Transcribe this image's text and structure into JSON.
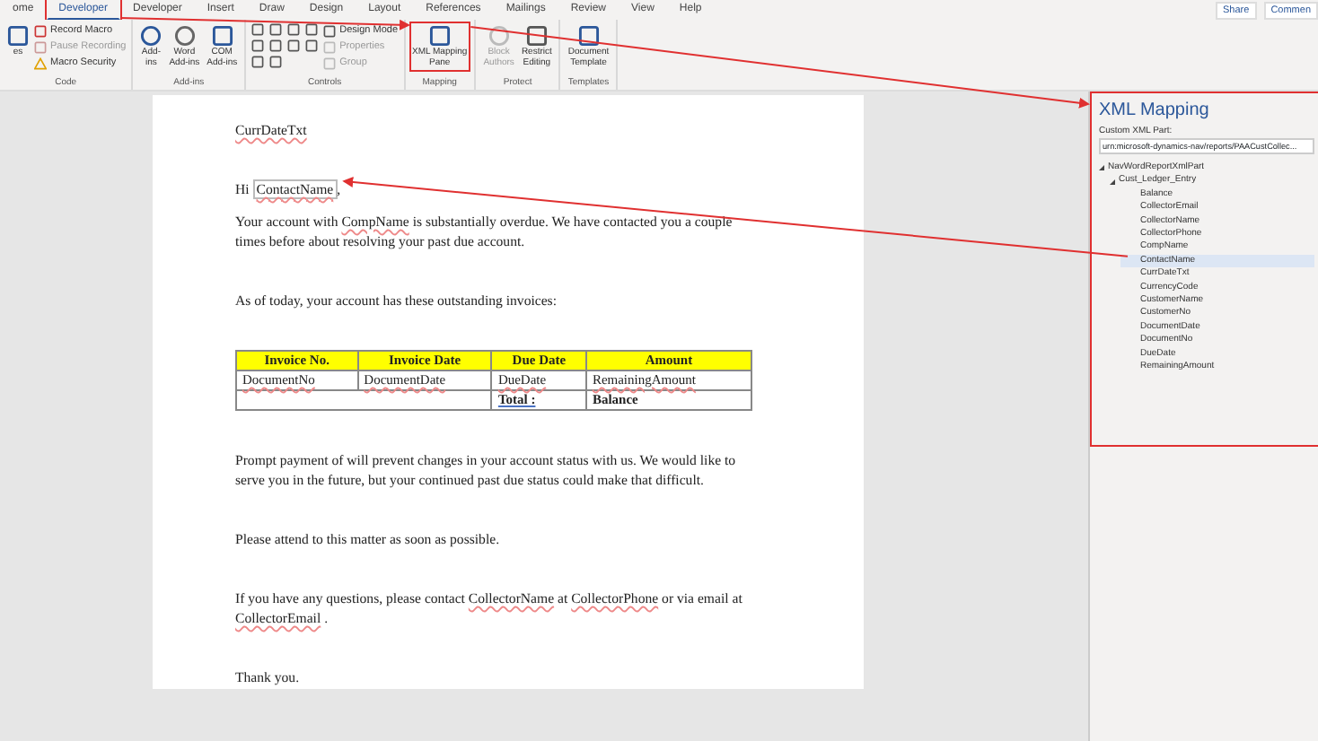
{
  "ribbon_tabs": [
    {
      "label": "ome",
      "selected": false,
      "highlighted": false
    },
    {
      "label": "Developer",
      "selected": true,
      "highlighted": true
    },
    {
      "label": "Developer",
      "selected": false,
      "highlighted": false
    },
    {
      "label": "Insert",
      "selected": false,
      "highlighted": false
    },
    {
      "label": "Draw",
      "selected": false,
      "highlighted": false
    },
    {
      "label": "Design",
      "selected": false,
      "highlighted": false
    },
    {
      "label": "Layout",
      "selected": false,
      "highlighted": false
    },
    {
      "label": "References",
      "selected": false,
      "highlighted": false
    },
    {
      "label": "Mailings",
      "selected": false,
      "highlighted": false
    },
    {
      "label": "Review",
      "selected": false,
      "highlighted": false
    },
    {
      "label": "View",
      "selected": false,
      "highlighted": false
    },
    {
      "label": "Help",
      "selected": false,
      "highlighted": false
    }
  ],
  "share_buttons": [
    "Share",
    "Commen"
  ],
  "ribbon_groups": [
    {
      "name": "Code",
      "buttons": [
        {
          "kind": "large",
          "label": "es",
          "disabled": false,
          "highlighted": false
        },
        {
          "kind": "stack",
          "items": [
            {
              "label": "Record Macro",
              "disabled": false
            },
            {
              "label": "Pause Recording",
              "disabled": true
            },
            {
              "label": "Macro Security",
              "disabled": false
            }
          ]
        }
      ]
    },
    {
      "name": "Add-ins",
      "buttons": [
        {
          "kind": "large",
          "label": "Add-\nins",
          "disabled": false,
          "highlighted": false
        },
        {
          "kind": "large",
          "label": "Word\nAdd-ins",
          "disabled": false,
          "highlighted": false
        },
        {
          "kind": "large",
          "label": "COM\nAdd-ins",
          "disabled": false,
          "highlighted": false
        }
      ]
    },
    {
      "name": "Controls",
      "buttons": [
        {
          "kind": "controls"
        },
        {
          "kind": "stack",
          "items": [
            {
              "label": "Design Mode",
              "disabled": false
            },
            {
              "label": "Properties",
              "disabled": true
            },
            {
              "label": "Group",
              "disabled": true
            }
          ]
        }
      ]
    },
    {
      "name": "Mapping",
      "buttons": [
        {
          "kind": "large",
          "label": "XML Mapping\nPane",
          "disabled": false,
          "highlighted": true
        }
      ]
    },
    {
      "name": "Protect",
      "buttons": [
        {
          "kind": "large",
          "label": "Block\nAuthors",
          "disabled": true,
          "highlighted": false
        },
        {
          "kind": "large",
          "label": "Restrict\nEditing",
          "disabled": false,
          "highlighted": false
        }
      ]
    },
    {
      "name": "Templates",
      "buttons": [
        {
          "kind": "large",
          "label": "Document\nTemplate",
          "disabled": false,
          "highlighted": false
        }
      ]
    }
  ],
  "document": {
    "blocks": [
      {
        "kind": "para",
        "segments": [
          {
            "text": "CurrDateTxt",
            "field": true
          }
        ]
      },
      {
        "kind": "gap"
      },
      {
        "kind": "para",
        "segments": [
          {
            "text": "Hi ",
            "field": false
          },
          {
            "text": "ContactName",
            "field": true,
            "control": true
          },
          {
            "text": ","
          }
        ]
      },
      {
        "kind": "para",
        "segments": [
          {
            "text": "Your account with ",
            "field": false
          },
          {
            "text": "CompName",
            "field": true
          },
          {
            "text": " is substantially overdue.  We have contacted you a couple times before about resolving your past due account.",
            "field": false
          }
        ]
      },
      {
        "kind": "gap"
      },
      {
        "kind": "para",
        "segments": [
          {
            "text": "As of today, your account has these outstanding invoices:",
            "field": false
          }
        ]
      },
      {
        "kind": "gap"
      },
      {
        "kind": "table",
        "columns": [
          "Invoice No.",
          "Invoice Date",
          "Due Date",
          "Amount"
        ],
        "row": [
          "DocumentNo",
          "DocumentDate",
          "DueDate",
          "RemainingAmount"
        ],
        "total_label": "Total :",
        "total_value": "Balance"
      },
      {
        "kind": "gap"
      },
      {
        "kind": "para",
        "segments": [
          {
            "text": "Prompt payment of will prevent changes in your account status with us.  We would like to serve you in the future, but your continued past due status could make that difficult.",
            "field": false
          }
        ]
      },
      {
        "kind": "gap"
      },
      {
        "kind": "para",
        "segments": [
          {
            "text": "Please attend to this matter as soon as possible.",
            "field": false
          }
        ]
      },
      {
        "kind": "gap"
      },
      {
        "kind": "para",
        "segments": [
          {
            "text": "If you have any questions, please contact ",
            "field": false
          },
          {
            "text": "CollectorName",
            "field": true
          },
          {
            "text": " at ",
            "field": false
          },
          {
            "text": "CollectorPhone",
            "field": true
          },
          {
            "text": " or via email at ",
            "field": false
          },
          {
            "text": "CollectorEmail",
            "field": true
          },
          {
            "text": " .",
            "field": false
          }
        ]
      },
      {
        "kind": "gap"
      },
      {
        "kind": "para",
        "segments": [
          {
            "text": "Thank you.",
            "field": false
          }
        ]
      }
    ]
  },
  "xml_pane": {
    "title": "XML Mapping",
    "highlighted": true,
    "part_label": "Custom XML Part:",
    "part_value": "urn:microsoft-dynamics-nav/reports/PAACustCollec...",
    "tree": [
      {
        "label": "NavWordReportXmlPart",
        "expanded": true,
        "selected": false,
        "children": [
          {
            "label": "Cust_Ledger_Entry",
            "expanded": true,
            "selected": false,
            "children": [
              {
                "label": "Balance",
                "selected": false
              },
              {
                "label": "CollectorEmail",
                "selected": false
              },
              {
                "label": "CollectorName",
                "selected": false
              },
              {
                "label": "CollectorPhone",
                "selected": false
              },
              {
                "label": "CompName",
                "selected": false
              },
              {
                "label": "ContactName",
                "selected": true
              },
              {
                "label": "CurrDateTxt",
                "selected": false
              },
              {
                "label": "CurrencyCode",
                "selected": false
              },
              {
                "label": "CustomerName",
                "selected": false
              },
              {
                "label": "CustomerNo",
                "selected": false
              },
              {
                "label": "DocumentDate",
                "selected": false
              },
              {
                "label": "DocumentNo",
                "selected": false
              },
              {
                "label": "DueDate",
                "selected": false
              },
              {
                "label": "RemainingAmount",
                "selected": false
              }
            ]
          }
        ]
      }
    ]
  }
}
